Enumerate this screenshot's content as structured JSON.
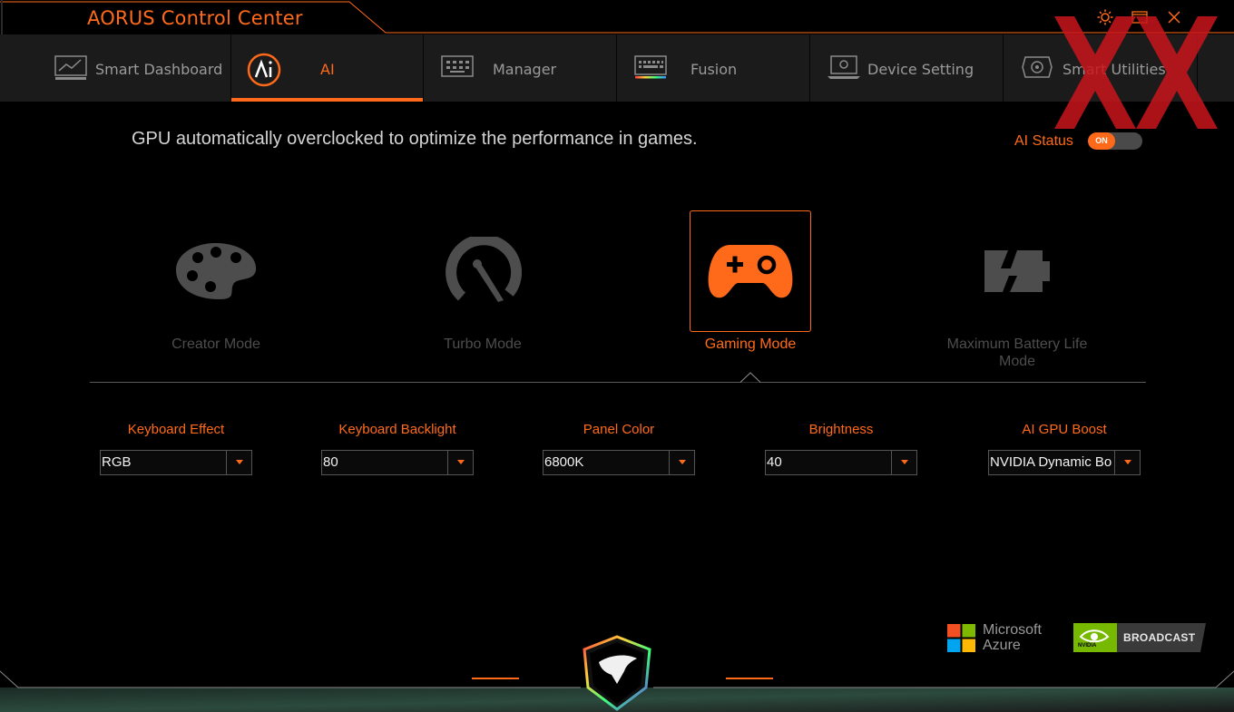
{
  "window": {
    "title": "AORUS Control Center",
    "controls": [
      "settings-icon",
      "restore-icon",
      "close-icon"
    ]
  },
  "tabs": [
    {
      "label": "Smart Dashboard",
      "icon": "dashboard-icon",
      "active": false
    },
    {
      "label": "AI",
      "icon": "ai-icon",
      "active": true
    },
    {
      "label": "Manager",
      "icon": "manager-icon",
      "active": false
    },
    {
      "label": "Fusion",
      "icon": "keyboard-icon",
      "active": false
    },
    {
      "label": "Device Setting",
      "icon": "device-icon",
      "active": false
    },
    {
      "label": "Smart Utilities",
      "icon": "utilities-icon",
      "active": false
    }
  ],
  "main": {
    "description": "GPU automatically overclocked to optimize the performance in games.",
    "ai_status": {
      "label": "AI Status",
      "value": "ON"
    }
  },
  "modes": [
    {
      "label": "Creator Mode",
      "icon": "palette-icon",
      "selected": false
    },
    {
      "label": "Turbo Mode",
      "icon": "speedometer-icon",
      "selected": false
    },
    {
      "label": "Gaming Mode",
      "icon": "gamepad-icon",
      "selected": true
    },
    {
      "label": "Maximum Battery Life Mode",
      "icon": "battery-icon",
      "selected": false
    }
  ],
  "settings": [
    {
      "label": "Keyboard Effect",
      "value": "RGB"
    },
    {
      "label": "Keyboard Backlight",
      "value": "80"
    },
    {
      "label": "Panel Color",
      "value": "6800K"
    },
    {
      "label": "Brightness",
      "value": "40"
    },
    {
      "label": "AI GPU Boost",
      "value": "NVIDIA Dynamic Boost"
    }
  ],
  "brands": {
    "microsoft": {
      "line1": "Microsoft",
      "line2": "Azure"
    },
    "nvidia": {
      "brand": "NVIDIA",
      "label": "BROADCAST"
    }
  },
  "colors": {
    "accent": "#ff6a1a",
    "background": "#000000",
    "panel": "#1b1b1b",
    "inactive": "#4d4d4d"
  }
}
